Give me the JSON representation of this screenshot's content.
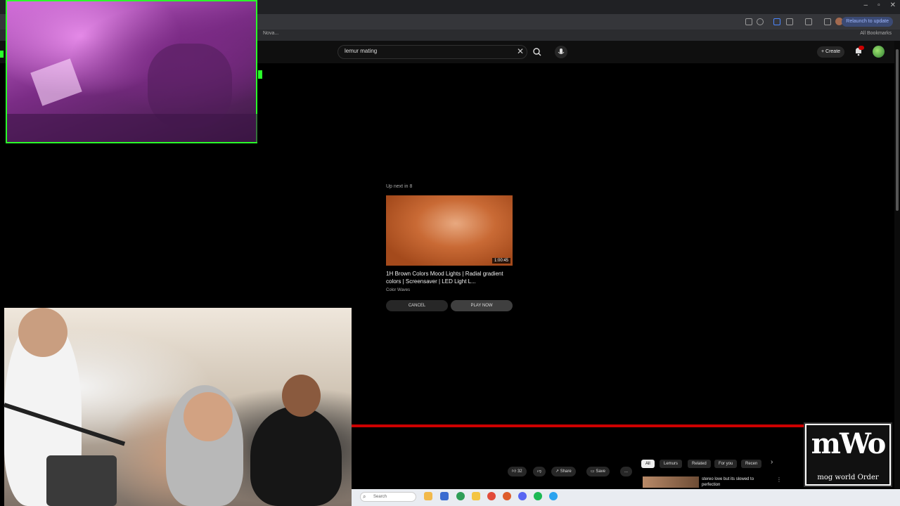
{
  "browser": {
    "relaunch_label": "Relaunch to update",
    "bookmarks_label": "All Bookmarks",
    "bookmark_left": "Nova..."
  },
  "youtube": {
    "search_query": "lemur mating",
    "create_label": "+ Create"
  },
  "up_next": {
    "label": "Up next in 8",
    "duration": "1:00:45",
    "title": "1H Brown Colors Mood Lights | Radial gradient colors | Screensaver | LED Light L...",
    "channel": "Color Waves",
    "cancel_label": "CANCEL",
    "play_now_label": "PLAY NOW"
  },
  "player": {
    "progress": 1.0,
    "like_count": "32",
    "share_label": "Share",
    "save_label": "Save",
    "more_label": "...",
    "chips": [
      "All",
      "Lemurs",
      "Related",
      "For you",
      "Recen"
    ],
    "next_arrow": "›",
    "rec_title": "stereo love but its slowed to perfection"
  },
  "taskbar": {
    "search_placeholder": "Search"
  },
  "logo": {
    "main": "mWo",
    "sub": "mog world Order"
  },
  "colors": {
    "cam_border": "#2aff2a",
    "progress": "#cc0000",
    "background": "#000000"
  }
}
